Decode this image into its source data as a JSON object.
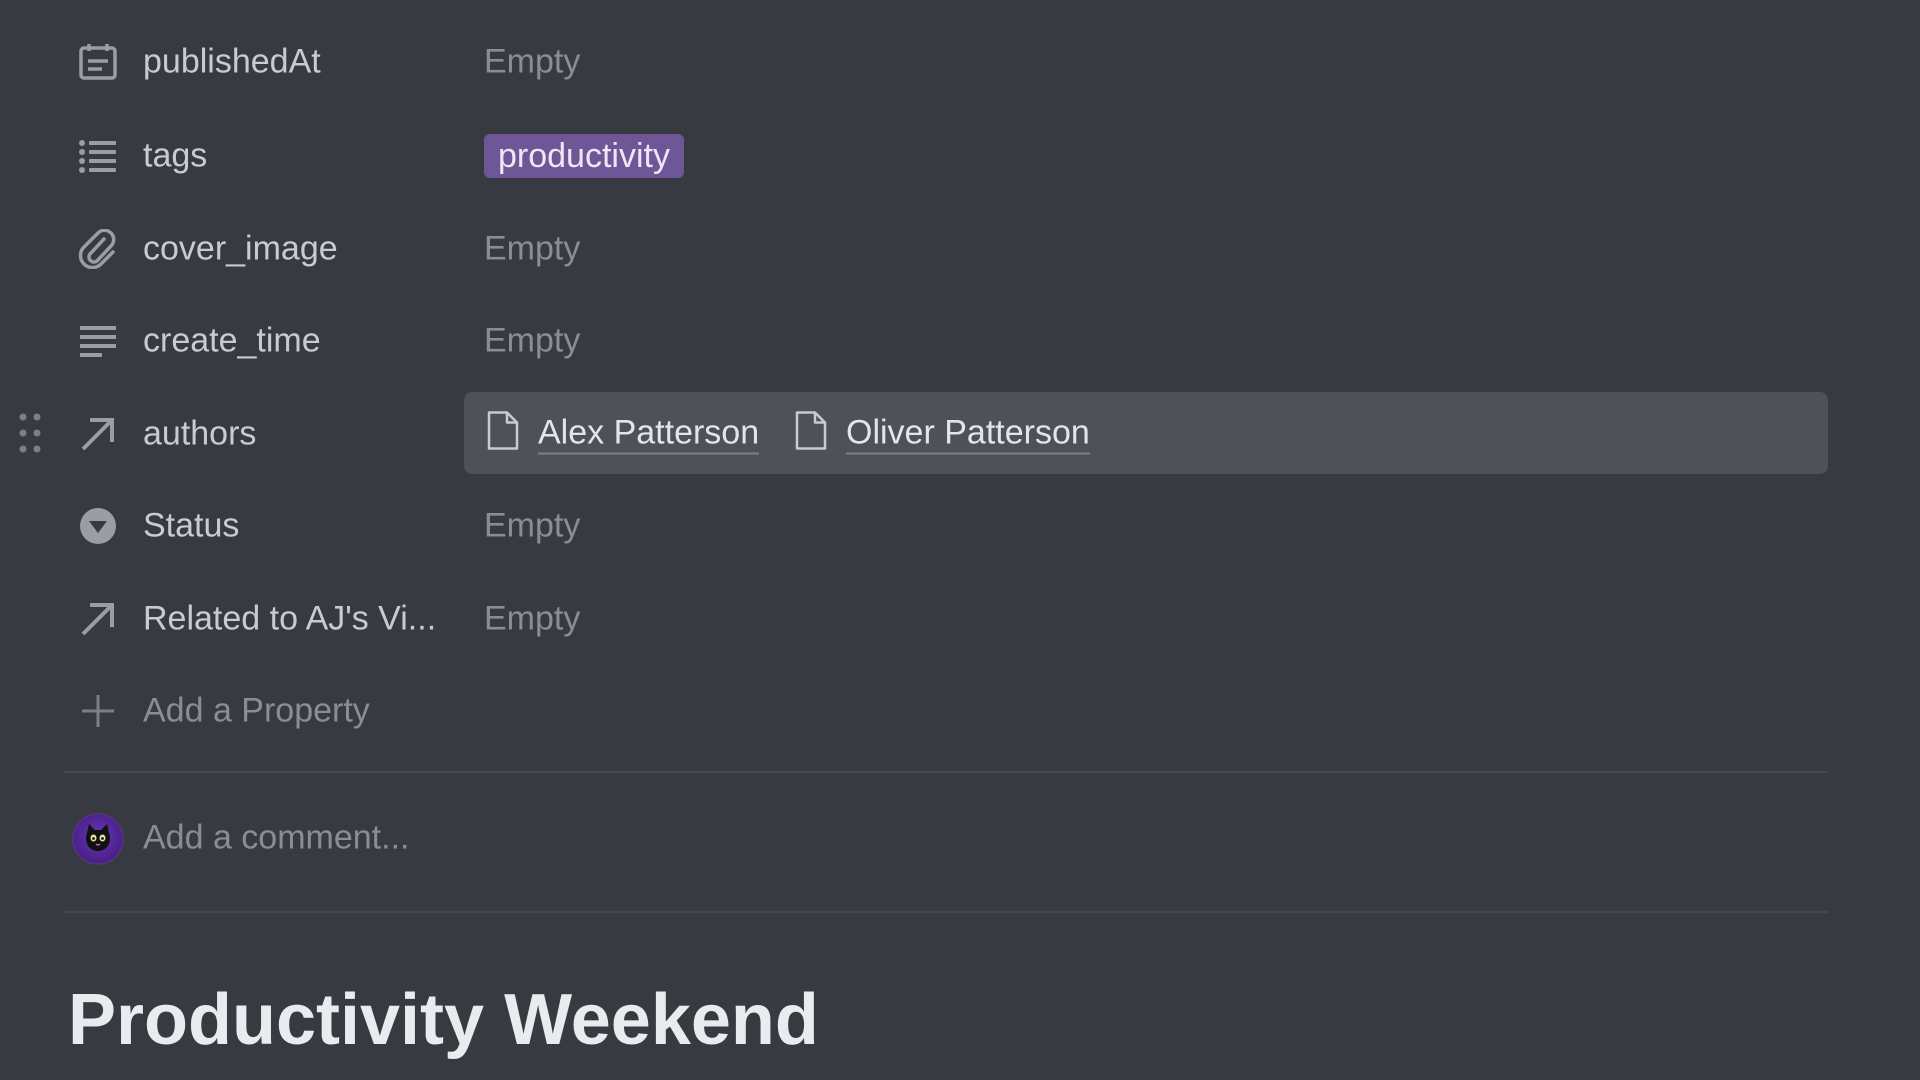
{
  "properties": [
    {
      "name": "publishedAt",
      "icon": "calendar-icon",
      "value": "Empty"
    },
    {
      "name": "tags",
      "icon": "list-icon",
      "tag": "productivity"
    },
    {
      "name": "cover_image",
      "icon": "paperclip-icon",
      "value": "Empty"
    },
    {
      "name": "create_time",
      "icon": "text-lines-icon",
      "value": "Empty"
    },
    {
      "name": "authors",
      "icon": "relation-arrow-icon",
      "authors": [
        "Alex Patterson",
        "Oliver Patterson"
      ]
    },
    {
      "name": "Status",
      "icon": "status-chevron-icon",
      "value": "Empty"
    },
    {
      "name": "Related to AJ's Vi...",
      "icon": "relation-arrow-icon",
      "value": "Empty"
    }
  ],
  "add_property_label": "Add a Property",
  "comment": {
    "placeholder": "Add a comment...",
    "avatar_icon": "cat-avatar"
  },
  "page_title": "Productivity Weekend",
  "colors": {
    "background": "#373a40",
    "tag_background": "#6e5697",
    "authors_highlight": "#4e5157"
  }
}
